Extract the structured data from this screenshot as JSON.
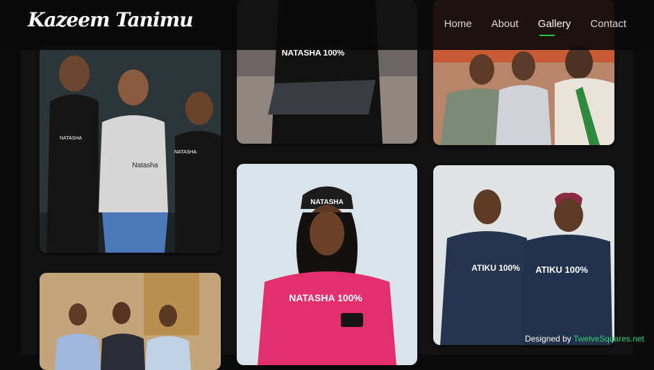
{
  "header": {
    "logo": "Kazeem Tanimu",
    "nav": [
      {
        "label": "Home"
      },
      {
        "label": "About"
      },
      {
        "label": "Gallery"
      },
      {
        "label": "Contact"
      }
    ],
    "active_item": "Gallery",
    "accent_color": "#1ecb48"
  },
  "gallery": {
    "photos": [
      {
        "name": "photo-three-people-natasha-shirts",
        "caption": "Natasha",
        "shirt_text": "NATASHA"
      },
      {
        "name": "photo-laptop-natasha-tee",
        "caption": "NATASHA 100%"
      },
      {
        "name": "photo-men-greeting",
        "caption": ""
      },
      {
        "name": "photo-pink-natasha-tee-cap",
        "cap_text": "NATASHA",
        "caption": "NATASHA 100%"
      },
      {
        "name": "photo-two-men-atiku-sweatshirts",
        "shirt_left": "ATIKU 100%",
        "shirt_right": "ATIKU 100%"
      },
      {
        "name": "photo-group-men-office",
        "caption": ""
      }
    ]
  },
  "footer": {
    "credit_prefix": "Designed by",
    "credit_link": "TwelveSquares.net"
  }
}
